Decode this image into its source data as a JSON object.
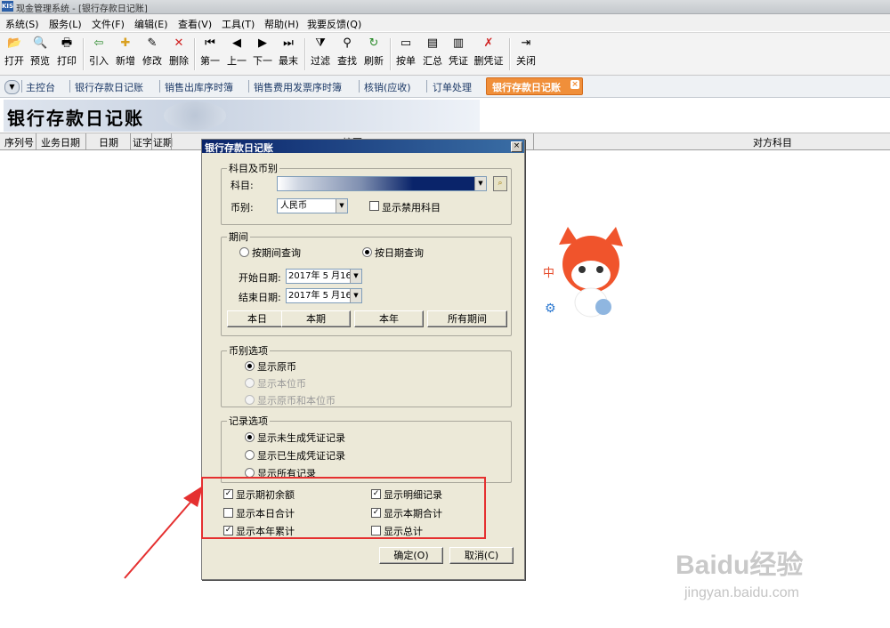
{
  "window": {
    "logo": "KIS",
    "title": "现金管理系统 - [银行存款日记账]"
  },
  "menu": [
    "系统(S)",
    "服务(L)",
    "文件(F)",
    "编辑(E)",
    "查看(V)",
    "工具(T)",
    "帮助(H)",
    "我要反馈(Q)"
  ],
  "toolbar": [
    {
      "label": "打开",
      "icon": "folder-icon",
      "glyph": "📂"
    },
    {
      "label": "预览",
      "icon": "preview-icon",
      "glyph": "🔍"
    },
    {
      "label": "打印",
      "icon": "printer-icon",
      "glyph": "🖶"
    },
    {
      "label": "引入",
      "icon": "import-icon",
      "glyph": "⇦"
    },
    {
      "label": "新增",
      "icon": "new-icon",
      "glyph": "✚"
    },
    {
      "label": "修改",
      "icon": "edit-icon",
      "glyph": "✎"
    },
    {
      "label": "删除",
      "icon": "delete-icon",
      "glyph": "✕"
    },
    {
      "label": "第一",
      "icon": "first-icon",
      "glyph": "⏮"
    },
    {
      "label": "上一",
      "icon": "prev-icon",
      "glyph": "◀"
    },
    {
      "label": "下一",
      "icon": "next-icon",
      "glyph": "▶"
    },
    {
      "label": "最末",
      "icon": "last-icon",
      "glyph": "⏭"
    },
    {
      "label": "过滤",
      "icon": "filter-icon",
      "glyph": "⧩"
    },
    {
      "label": "查找",
      "icon": "binoculars-icon",
      "glyph": "⚲"
    },
    {
      "label": "刷新",
      "icon": "refresh-icon",
      "glyph": "↻"
    },
    {
      "label": "按单",
      "icon": "document-icon",
      "glyph": "▭"
    },
    {
      "label": "汇总",
      "icon": "summary-icon",
      "glyph": "▤"
    },
    {
      "label": "凭证",
      "icon": "voucher-icon",
      "glyph": "▥"
    },
    {
      "label": "删凭证",
      "icon": "delete-voucher-icon",
      "glyph": "✗"
    },
    {
      "label": "关闭",
      "icon": "exit-icon",
      "glyph": "⇥"
    }
  ],
  "tabs": [
    "主控台",
    "银行存款日记账",
    "销售出库序时簿",
    "销售费用发票序时簿",
    "核销(应收)",
    "订单处理",
    "银行存款日记账"
  ],
  "page_title": "银行存款日记账",
  "grid_headers": [
    "序列号",
    "业务日期",
    "日期",
    "证字",
    "证期",
    "摘要",
    "对方科目"
  ],
  "dialog": {
    "title": "银行存款日记账",
    "subject_group": {
      "legend": "科目及币别",
      "subject_label": "科目:",
      "currency_label": "币别:",
      "currency_value": "人民币",
      "show_disabled_label": "显示禁用科目",
      "show_disabled_checked": false
    },
    "period_group": {
      "legend": "期间",
      "by_period": "按期间查询",
      "by_date": "按日期查询",
      "selected": "by_date",
      "start_label": "开始日期:",
      "start_value": "2017年 5 月16日",
      "end_label": "结束日期:",
      "end_value": "2017年 5 月16日",
      "buttons": [
        "本日",
        "本期",
        "本年",
        "所有期间"
      ]
    },
    "currency_options": {
      "legend": "币别选项",
      "options": [
        {
          "label": "显示原币",
          "selected": true,
          "enabled": true
        },
        {
          "label": "显示本位币",
          "selected": false,
          "enabled": false
        },
        {
          "label": "显示原币和本位币",
          "selected": false,
          "enabled": false
        }
      ]
    },
    "record_options": {
      "legend": "记录选项",
      "options": [
        {
          "label": "显示未生成凭证记录",
          "selected": true
        },
        {
          "label": "显示已生成凭证记录",
          "selected": false
        },
        {
          "label": "显示所有记录",
          "selected": false
        }
      ]
    },
    "checkboxes": [
      {
        "label": "显示期初余额",
        "checked": true
      },
      {
        "label": "显示明细记录",
        "checked": true
      },
      {
        "label": "显示本日合计",
        "checked": false
      },
      {
        "label": "显示本期合计",
        "checked": true
      },
      {
        "label": "显示本年累计",
        "checked": true
      },
      {
        "label": "显示总计",
        "checked": false
      }
    ],
    "ok": "确定(O)",
    "cancel": "取消(C)"
  },
  "mascot_text": "中",
  "watermark": {
    "brand": "Baidu经验",
    "url": "jingyan.baidu.com"
  },
  "colors": {
    "highlight": "#e53030",
    "active_tab": "#f08f3a",
    "dialog_title": "#0a246a"
  }
}
